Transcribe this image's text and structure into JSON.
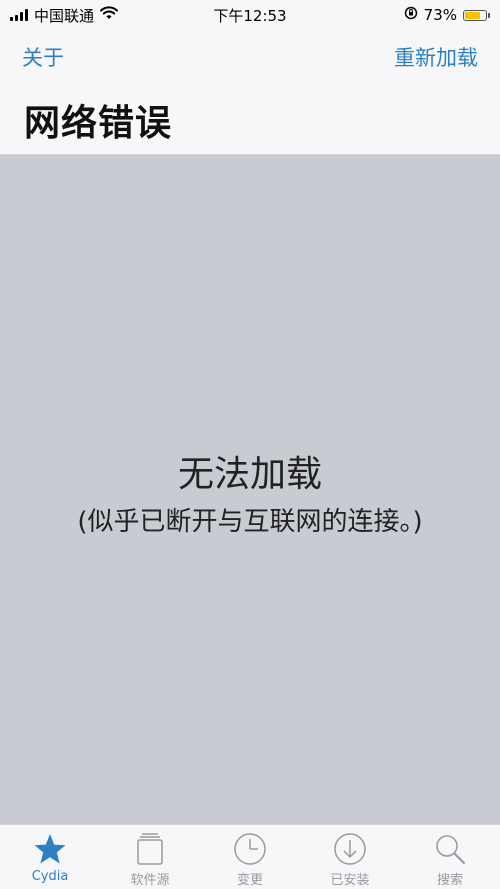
{
  "status_bar": {
    "carrier": "中国联通",
    "time": "下午12:53",
    "battery_percent": "73%",
    "battery_level": 0.73,
    "signal_icon": "signal-bars-icon",
    "wifi_icon": "wifi-icon",
    "rotation_lock_icon": "rotation-lock-icon"
  },
  "nav": {
    "left_button": "关于",
    "right_button": "重新加载",
    "title": "网络错误"
  },
  "content": {
    "error_title": "无法加载",
    "error_message": "(似乎已断开与互联网的连接。)"
  },
  "tab_bar": {
    "tabs": [
      {
        "label": "Cydia",
        "icon": "star-icon",
        "active": true
      },
      {
        "label": "软件源",
        "icon": "sources-icon",
        "active": false
      },
      {
        "label": "变更",
        "icon": "clock-icon",
        "active": false
      },
      {
        "label": "已安装",
        "icon": "download-icon",
        "active": false
      },
      {
        "label": "搜索",
        "icon": "search-icon",
        "active": false
      }
    ]
  },
  "colors": {
    "accent": "#2e80c4",
    "content_background": "#c8ccd2",
    "bar_background": "#f7f7f9",
    "inactive_tab": "#9a9a9e",
    "battery_fill": "#f5c400"
  }
}
